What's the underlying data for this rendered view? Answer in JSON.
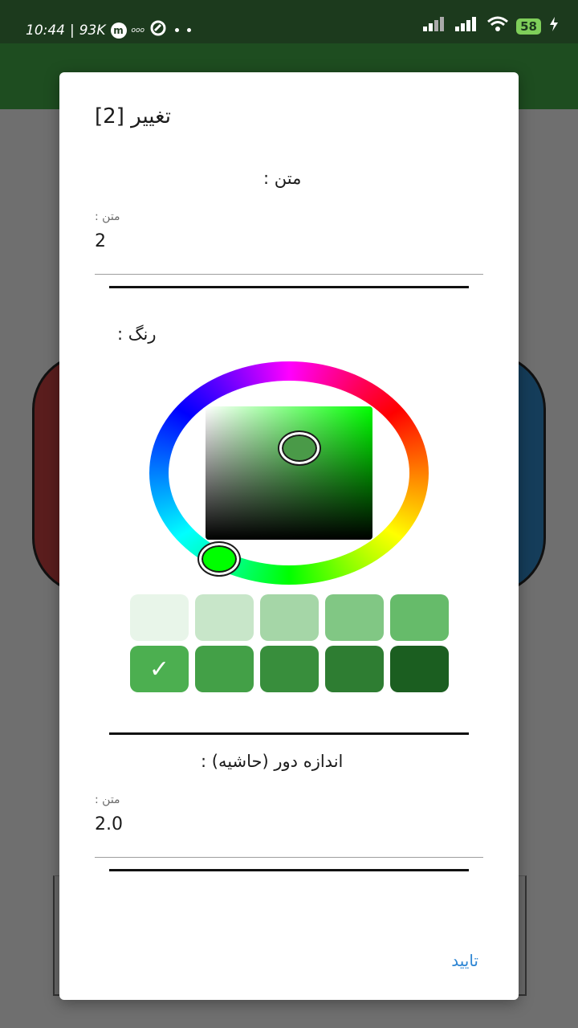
{
  "status_bar": {
    "time": "10:44",
    "separator": "|",
    "speed": "93K",
    "app_glyph": "m",
    "small_icon_text": "ooo",
    "battery": "58"
  },
  "dialog": {
    "title": "تغییر [2]",
    "text_section_label": ": متن",
    "text_field_hint": ": متن",
    "text_field_value": "2",
    "color_section_label": ": رنگ",
    "selected_color": "#4caf50",
    "swatches": [
      {
        "color": "#e8f5e9",
        "selected": false
      },
      {
        "color": "#c8e6c9",
        "selected": false
      },
      {
        "color": "#a5d6a7",
        "selected": false
      },
      {
        "color": "#81c784",
        "selected": false
      },
      {
        "color": "#66bb6a",
        "selected": false
      },
      {
        "color": "#4caf50",
        "selected": true
      },
      {
        "color": "#43a047",
        "selected": false
      },
      {
        "color": "#388e3c",
        "selected": false
      },
      {
        "color": "#2e7d32",
        "selected": false
      },
      {
        "color": "#1b5e20",
        "selected": false
      }
    ],
    "border_section_label": ": اندازه دور (حاشیه)",
    "border_field_hint": ": متن",
    "border_field_value": "2.0",
    "confirm_label": "تایید"
  },
  "colors": {
    "status_bar": "#1c3a1d",
    "app_bar": "#1e4d20",
    "scrim": "#6f6f6f",
    "accent_link": "#2e86d4"
  }
}
